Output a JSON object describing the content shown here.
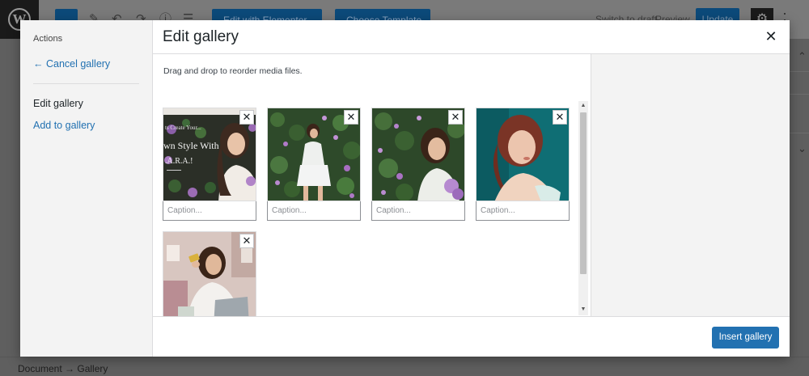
{
  "background": {
    "topbar": {
      "btn_elementor": "Edit with Elementor",
      "btn_template": "Choose Template",
      "switch_draft": "Switch to draft",
      "preview": "Preview",
      "update": "Update"
    },
    "breadcrumb": "Document → Gallery"
  },
  "menu": {
    "heading": "Actions",
    "cancel": "← Cancel gallery",
    "edit": "Edit gallery",
    "add": "Add to gallery"
  },
  "modal": {
    "title": "Edit gallery",
    "instructions": "Drag and drop to reorder media files.",
    "caption_placeholder": "Caption...",
    "insert": "Insert gallery"
  },
  "thumb1": {
    "line1": "ts Create Your...",
    "line2": "wn Style With",
    "line3": ".A.R.A.!"
  },
  "colors": {
    "accent": "#2271b1",
    "overlay_bg": "#5f5f5f",
    "modal_bg": "#ffffff"
  }
}
